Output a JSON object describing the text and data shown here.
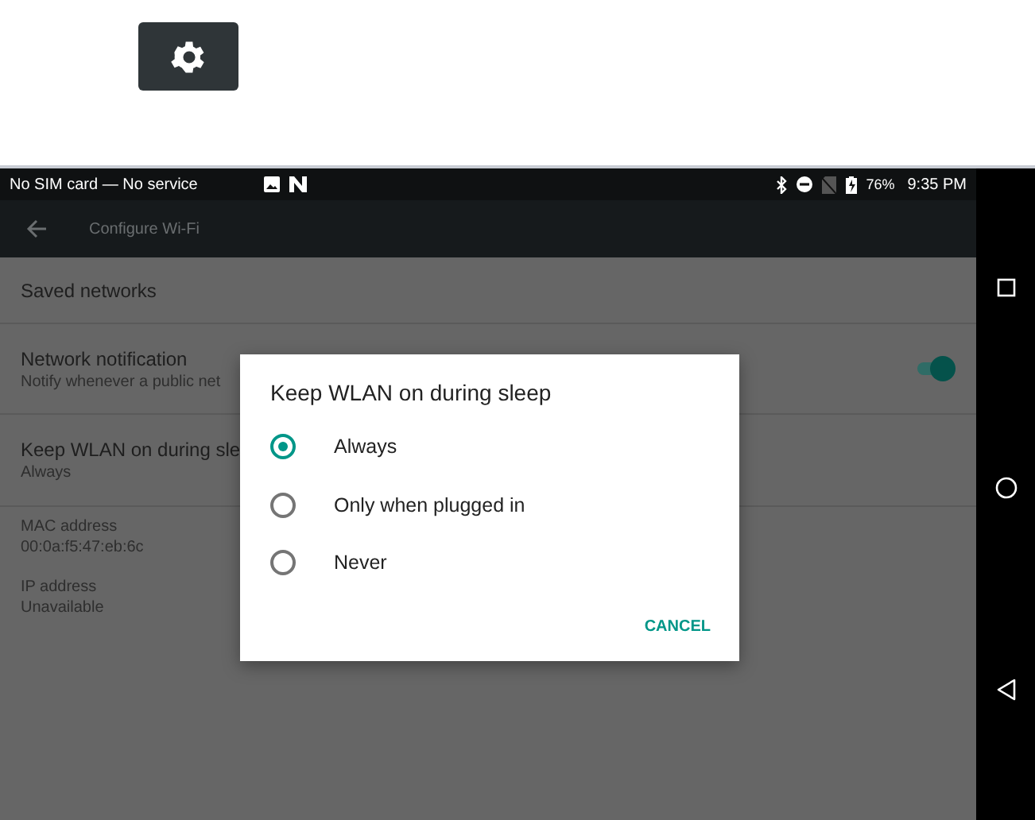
{
  "status_bar": {
    "carrier": "No SIM card — No service",
    "battery": "76%",
    "time": "9:35 PM"
  },
  "app_bar": {
    "title": "Configure Wi-Fi"
  },
  "settings": [
    {
      "kind": "plain",
      "title": "Saved networks"
    },
    {
      "kind": "toggle",
      "title": "Network notification",
      "subtitle": "Notify whenever a public net",
      "on": true
    },
    {
      "kind": "plain",
      "title": "Keep WLAN on during sle",
      "subtitle": "Always"
    },
    {
      "kind": "info",
      "title": "MAC address",
      "subtitle": "00:0a:f5:47:eb:6c"
    },
    {
      "kind": "info",
      "title": "IP address",
      "subtitle": "Unavailable"
    }
  ],
  "dialog": {
    "title": "Keep WLAN on during sleep",
    "options": [
      {
        "label": "Always",
        "selected": true
      },
      {
        "label": "Only when plugged in",
        "selected": false
      },
      {
        "label": "Never",
        "selected": false
      }
    ],
    "button": "CANCEL"
  }
}
